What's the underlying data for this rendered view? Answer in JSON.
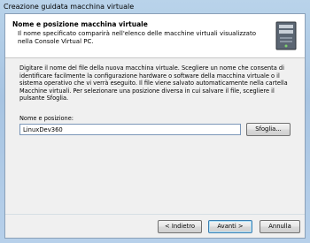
{
  "window": {
    "title": "Creazione guidata macchina virtuale"
  },
  "header": {
    "title": "Nome e posizione macchina virtuale",
    "subtitle": "Il nome specificato comparirà nell'elenco delle macchine virtuali visualizzato nella Console Virtual PC.",
    "icon": "computer-tower-icon"
  },
  "body": {
    "description": "Digitare il nome del file della nuova macchina virtuale. Scegliere un nome che consenta di identificare facilmente la configurazione hardware o software della macchina virtuale o il sistema operativo che vi verrà eseguito. Il file viene salvato automaticamente nella cartella Macchine virtuali. Per selezionare una posizione diversa in cui salvare il file, scegliere il pulsante Sfoglia."
  },
  "form": {
    "name_label": "Nome e posizione:",
    "name_value": "LinuxDev360",
    "browse_label": "Sfoglia..."
  },
  "footer": {
    "back_label": "< Indietro",
    "next_label": "Avanti >",
    "cancel_label": "Annulla"
  }
}
